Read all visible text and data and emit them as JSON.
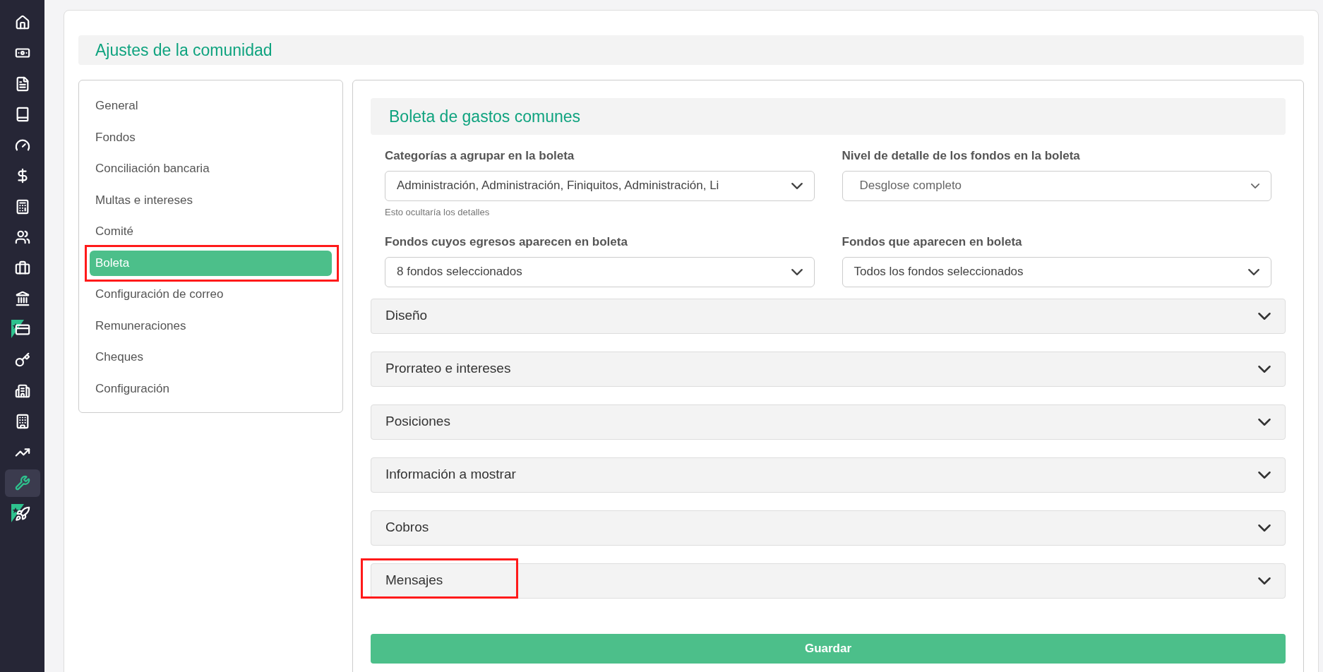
{
  "nav_icons": [
    {
      "selected": false
    },
    {
      "selected": false
    },
    {
      "selected": false
    },
    {
      "selected": false
    },
    {
      "selected": false
    },
    {
      "selected": false
    },
    {
      "selected": false
    },
    {
      "selected": false
    },
    {
      "selected": false
    },
    {
      "selected": false
    },
    {
      "selected": false
    },
    {
      "selected": false
    },
    {
      "selected": false
    },
    {
      "selected": false
    },
    {
      "selected": false
    },
    {
      "selected": true
    },
    {
      "selected": false
    }
  ],
  "page_title": "Ajustes de la comunidad",
  "settings_menu": [
    {
      "label": "General",
      "selected": false,
      "highlighted": false
    },
    {
      "label": "Fondos",
      "selected": false,
      "highlighted": false
    },
    {
      "label": "Conciliación bancaria",
      "selected": false,
      "highlighted": false
    },
    {
      "label": "Multas e intereses",
      "selected": false,
      "highlighted": false
    },
    {
      "label": "Comité",
      "selected": false,
      "highlighted": false
    },
    {
      "label": "Boleta",
      "selected": true,
      "highlighted": true
    },
    {
      "label": "Configuración de correo",
      "selected": false,
      "highlighted": false
    },
    {
      "label": "Remuneraciones",
      "selected": false,
      "highlighted": false
    },
    {
      "label": "Cheques",
      "selected": false,
      "highlighted": false
    },
    {
      "label": "Configuración",
      "selected": false,
      "highlighted": false
    }
  ],
  "section_title": "Boleta de gastos comunes",
  "fields": [
    {
      "label": "Categorías a agrupar en la boleta",
      "value": "Administración, Administración, Finiquitos, Administración, Li",
      "hint": "Esto ocultaría los detalles",
      "kind": "multiselect"
    },
    {
      "label": "Nivel de detalle de los fondos en la boleta",
      "value": "Desglose completo",
      "kind": "select"
    },
    {
      "label": "Fondos cuyos egresos aparecen en boleta",
      "value": "8 fondos seleccionados",
      "kind": "multiselect"
    },
    {
      "label": "Fondos que aparecen en boleta",
      "value": "Todos los fondos seleccionados",
      "kind": "multiselect"
    }
  ],
  "accordions": [
    {
      "label": "Diseño",
      "expanded": false,
      "highlighted": false
    },
    {
      "label": "Prorrateo e intereses",
      "expanded": false,
      "highlighted": false
    },
    {
      "label": "Posiciones",
      "expanded": false,
      "highlighted": false
    },
    {
      "label": "Información a mostrar",
      "expanded": false,
      "highlighted": false
    },
    {
      "label": "Cobros",
      "expanded": false,
      "highlighted": false
    },
    {
      "label": "Mensajes",
      "expanded": false,
      "highlighted": true
    }
  ],
  "save_button": "Guardar"
}
